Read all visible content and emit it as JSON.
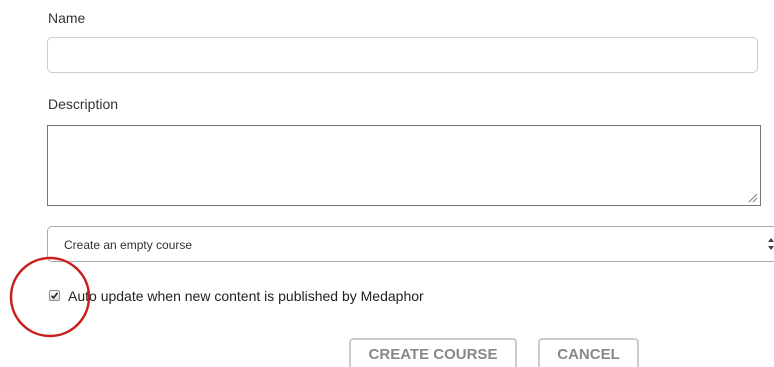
{
  "form": {
    "name_label": "Name",
    "name_value": "",
    "description_label": "Description",
    "description_value": "",
    "course_select": {
      "selected": "Create an empty course"
    },
    "auto_update": {
      "label": "Auto update when new content is published by Medaphor",
      "checked": true
    }
  },
  "actions": {
    "create_label": "CREATE COURSE",
    "cancel_label": "CANCEL"
  },
  "annotation": {
    "color": "#c81e1e"
  }
}
